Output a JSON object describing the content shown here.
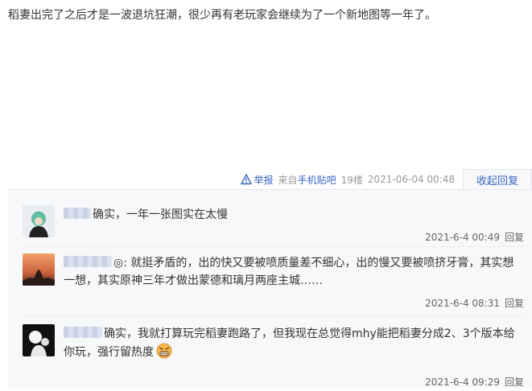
{
  "post": {
    "text": "稻妻出完了之后才是一波退坑狂潮，很少再有老玩家会继续为了一个新地图等一年了。"
  },
  "meta": {
    "report_label": "举报",
    "source_prefix": "来自",
    "source_link": "手机贴吧",
    "floor": "19楼",
    "timestamp": "2021-06-04 00:48",
    "fold_label": "收起回复"
  },
  "replies": [
    {
      "text": "确实，一年一张图实在太慢",
      "time": "2021-6-4 00:49",
      "reply_label": "回复"
    },
    {
      "text": "◎: 就挺矛盾的，出的快又要被喷质量差不细心，出的慢又要被喷挤牙膏，其实想一想，其实原神三年才做出蒙德和璃月两座主城……",
      "time": "2021-6-4 08:31",
      "reply_label": "回复"
    },
    {
      "text": "确实，我就打算玩完稻妻跑路了，但我现在总觉得mhy能把稻妻分成2、3个版本给你玩，强行留热度",
      "time": "2021-6-4 09:29",
      "reply_label": "回复"
    }
  ],
  "colors": {
    "link": "#3a67c4",
    "reply_bg": "#f7f8fa",
    "meta_gray": "#999999"
  }
}
